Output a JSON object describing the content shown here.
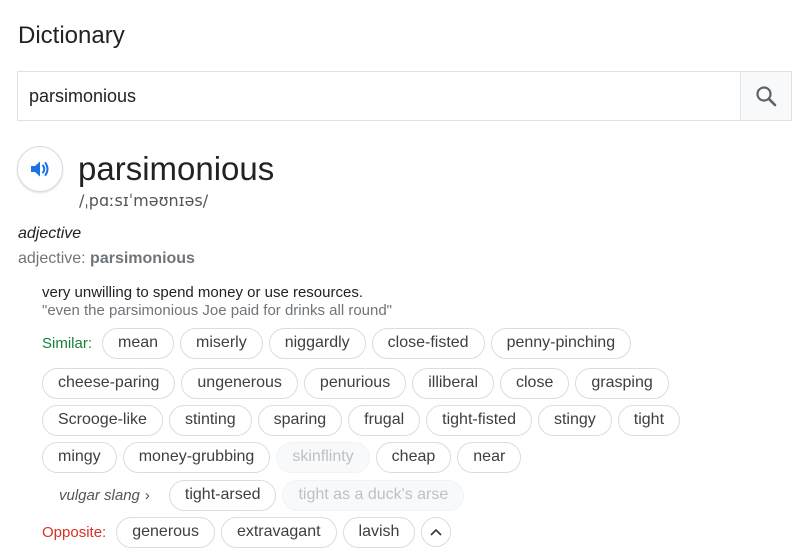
{
  "header": {
    "title": "Dictionary"
  },
  "search": {
    "value": "parsimonious"
  },
  "entry": {
    "word": "parsimonious",
    "phonetic": "/ˌpɑːsɪˈməʊnɪəs/",
    "part_of_speech": "adjective",
    "pos_prefix": "adjective: ",
    "pos_word": "parsimonious",
    "definition": "very unwilling to spend money or use resources.",
    "example": "\"even the parsimonious Joe paid for drinks all round\""
  },
  "similar": {
    "label": "Similar:",
    "row1": [
      "mean",
      "miserly",
      "niggardly",
      "close-fisted",
      "penny-pinching"
    ],
    "row2": [
      "cheese-paring",
      "ungenerous",
      "penurious",
      "illiberal",
      "close",
      "grasping"
    ],
    "row3": [
      "Scrooge-like",
      "stinting",
      "sparing",
      "frugal",
      "tight-fisted",
      "stingy",
      "tight"
    ],
    "row4": [
      "mingy",
      "money-grubbing",
      "skinflinty",
      "cheap",
      "near"
    ]
  },
  "vulgar": {
    "label": "vulgar slang",
    "chevron": "›",
    "items": [
      "tight-arsed",
      "tight as a duck's arse"
    ]
  },
  "opposite": {
    "label": "Opposite:",
    "items": [
      "generous",
      "extravagant",
      "lavish"
    ]
  },
  "icons": {
    "search": "search-icon",
    "speaker": "speaker-icon",
    "collapse": "chevron-up-icon"
  },
  "colors": {
    "similar_label": "#188038",
    "opposite_label": "#d93025",
    "speaker": "#1a73e8",
    "search_icon": "#5f6368"
  }
}
